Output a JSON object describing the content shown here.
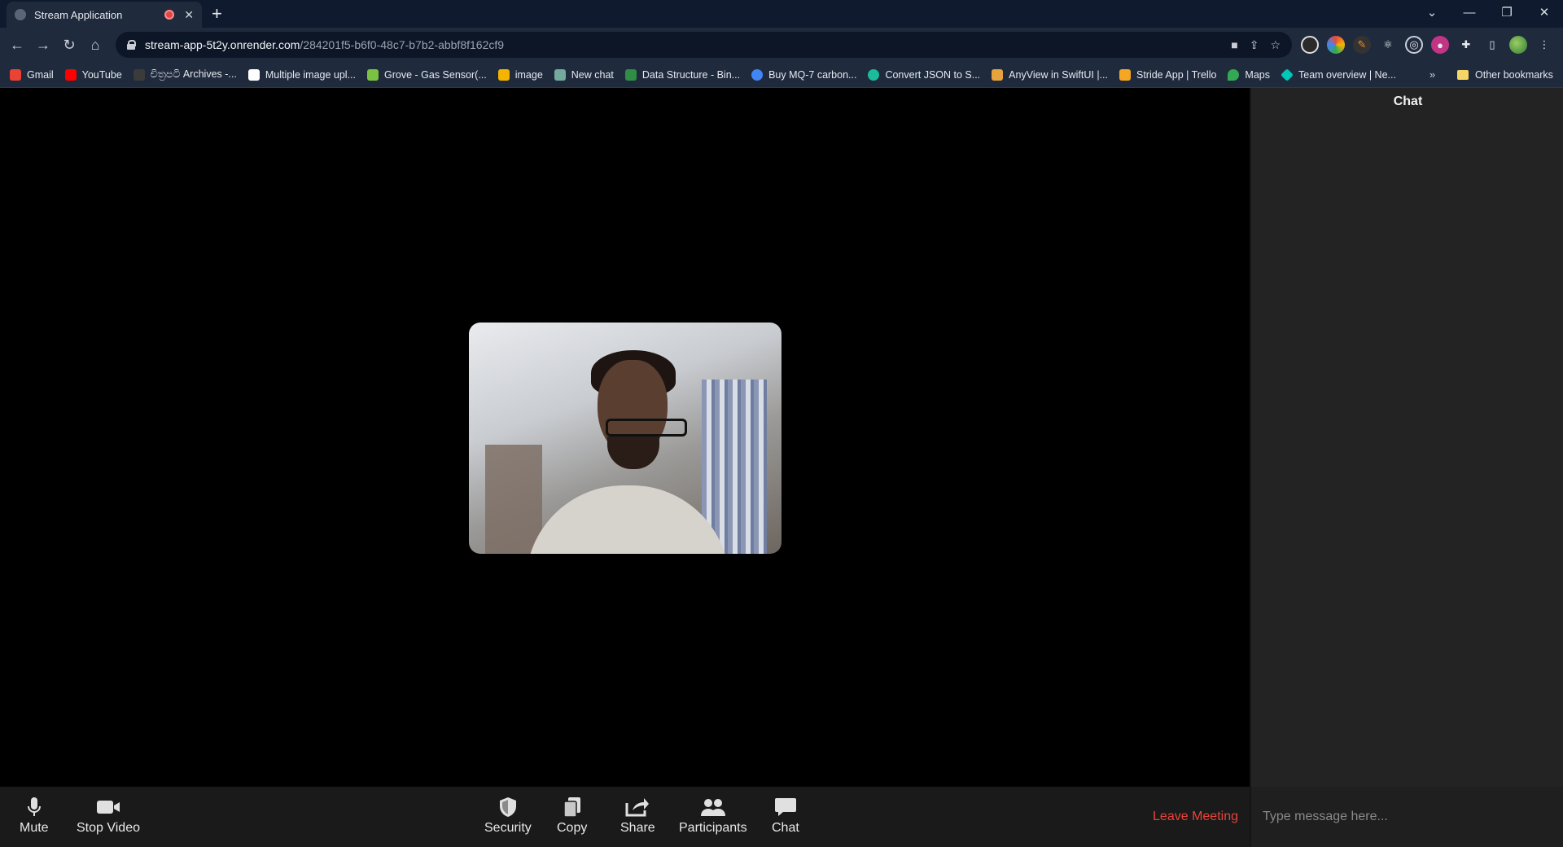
{
  "browser": {
    "tab_title": "Stream Application",
    "url_host": "stream-app-5t2y.onrender.com",
    "url_path": "/284201f5-b6f0-48c7-b7b2-abbf8f162cf9",
    "bookmarks": [
      {
        "label": "Gmail",
        "color": "#ea4335"
      },
      {
        "label": "YouTube",
        "color": "#ff0000"
      },
      {
        "label": "චිත්‍රපටි Archives -...",
        "color": "#3b3b3b"
      },
      {
        "label": "Multiple image upl...",
        "color": "#ffffff"
      },
      {
        "label": "Grove - Gas Sensor(...",
        "color": "#7cc242"
      },
      {
        "label": "image",
        "color": "#f4b400"
      },
      {
        "label": "New chat",
        "color": "#74aa9c"
      },
      {
        "label": "Data Structure - Bin...",
        "color": "#2f8d46"
      },
      {
        "label": "Buy MQ-7 carbon...",
        "color": "#4285f4"
      },
      {
        "label": "Convert JSON to S...",
        "color": "#1abc9c"
      },
      {
        "label": "AnyView in SwiftUI |...",
        "color": "#e8a33d"
      },
      {
        "label": "Stride App | Trello",
        "color": "#f5a623"
      },
      {
        "label": "Maps",
        "color": "#34a853"
      },
      {
        "label": "Team overview | Ne...",
        "color": "#00c7b7"
      }
    ],
    "bookmarks_more": "»",
    "other_bookmarks": "Other bookmarks"
  },
  "controls": {
    "mute": "Mute",
    "stop_video": "Stop Video",
    "security": "Security",
    "copy": "Copy",
    "share": "Share",
    "participants": "Participants",
    "chat": "Chat",
    "leave": "Leave Meeting"
  },
  "chat": {
    "title": "Chat",
    "placeholder": "Type message here..."
  }
}
